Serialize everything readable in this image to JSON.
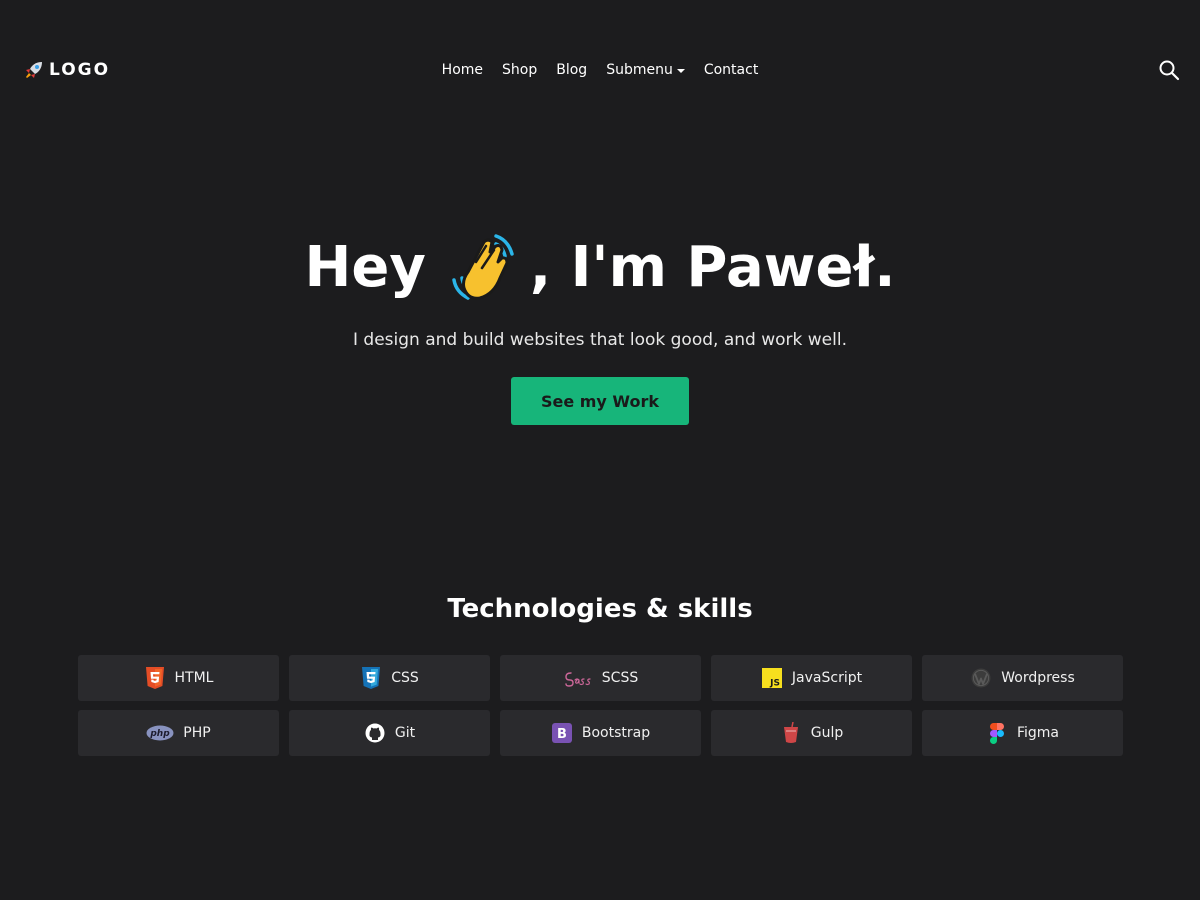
{
  "header": {
    "logo_icon": "rocket-icon",
    "logo_text": "LOGO",
    "nav": [
      {
        "label": "Home"
      },
      {
        "label": "Shop"
      },
      {
        "label": "Blog"
      },
      {
        "label": "Submenu",
        "dropdown": true
      },
      {
        "label": "Contact"
      }
    ],
    "search_icon": "search-icon"
  },
  "hero": {
    "title_before": "Hey",
    "title_emoji": "waving-hand-icon",
    "title_after": ", I'm Paweł.",
    "subtitle": "I design and build websites that look good, and work well.",
    "cta_label": "See my Work",
    "cta_color": "#17b57a"
  },
  "skills": {
    "title": "Technologies & skills",
    "items": [
      {
        "label": "HTML",
        "icon": "html5-icon",
        "color": "#e44d26"
      },
      {
        "label": "CSS",
        "icon": "css3-icon",
        "color": "#2965f1"
      },
      {
        "label": "SCSS",
        "icon": "sass-icon",
        "color": "#cd6799"
      },
      {
        "label": "JavaScript",
        "icon": "javascript-icon",
        "color": "#f7df1e"
      },
      {
        "label": "Wordpress",
        "icon": "wordpress-icon",
        "color": "#464646"
      },
      {
        "label": "PHP",
        "icon": "php-icon",
        "color": "#8892bf"
      },
      {
        "label": "Git",
        "icon": "github-icon",
        "color": "#ffffff"
      },
      {
        "label": "Bootstrap",
        "icon": "bootstrap-icon",
        "color": "#7952b3"
      },
      {
        "label": "Gulp",
        "icon": "gulp-icon",
        "color": "#cf4647"
      },
      {
        "label": "Figma",
        "icon": "figma-icon",
        "color": "#a259ff"
      }
    ]
  },
  "colors": {
    "background": "#1c1c1e",
    "card": "#2a2a2d",
    "accent": "#17b57a"
  }
}
